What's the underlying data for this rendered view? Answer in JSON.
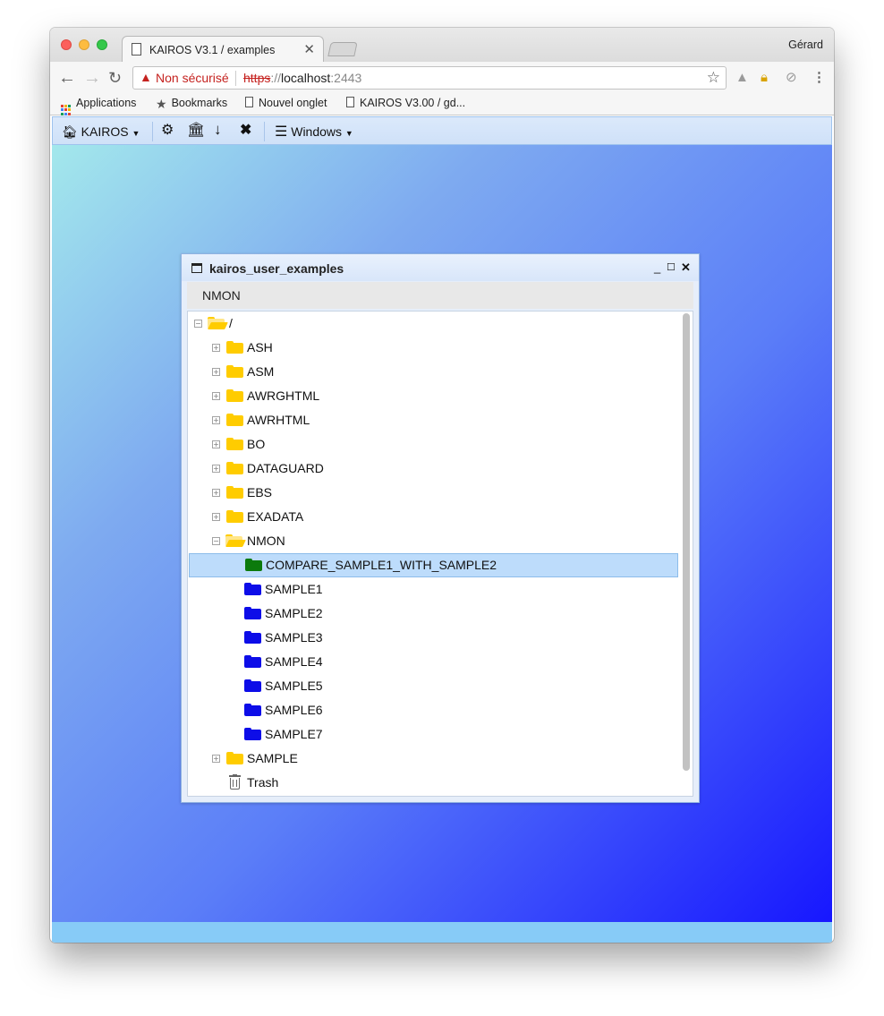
{
  "browser": {
    "tab_title": "KAIROS V3.1 / examples",
    "user": "Gérard",
    "address": {
      "warning": "Non sécurisé",
      "scheme": "https",
      "slashes": "://",
      "host": "localhost",
      "port": ":2443"
    },
    "bookmarks": [
      {
        "label": "Applications",
        "icon": "apps-grid-icon"
      },
      {
        "label": "Bookmarks",
        "icon": "star-icon"
      },
      {
        "label": "Nouvel onglet",
        "icon": "page-icon"
      },
      {
        "label": "KAIROS V3.00 / gd...",
        "icon": "page-icon"
      }
    ]
  },
  "app_toolbar": {
    "kairos_label": "KAIROS",
    "windows_label": "Windows",
    "icons": [
      "home-icon",
      "gear-icon",
      "bank-icon",
      "arrow-down-icon",
      "close-icon",
      "list-icon"
    ]
  },
  "dialog": {
    "title": "kairos_user_examples",
    "tab": "NMON",
    "tree": {
      "root": "/",
      "items": [
        {
          "label": "ASH",
          "color": "#ffcc00",
          "expanded": false
        },
        {
          "label": "ASM",
          "color": "#ffcc00",
          "expanded": false
        },
        {
          "label": "AWRGHTML",
          "color": "#ffcc00",
          "expanded": false
        },
        {
          "label": "AWRHTML",
          "color": "#ffcc00",
          "expanded": false
        },
        {
          "label": "BO",
          "color": "#ffcc00",
          "expanded": false
        },
        {
          "label": "DATAGUARD",
          "color": "#ffcc00",
          "expanded": false
        },
        {
          "label": "EBS",
          "color": "#ffcc00",
          "expanded": false
        },
        {
          "label": "EXADATA",
          "color": "#ffcc00",
          "expanded": false
        },
        {
          "label": "NMON",
          "color": "#ffcc00",
          "expanded": true
        },
        {
          "label": "COMPARE_SAMPLE1_WITH_SAMPLE2",
          "color": "#0c7a0c",
          "selected": true
        },
        {
          "label": "SAMPLE1",
          "color": "#0d0de8"
        },
        {
          "label": "SAMPLE2",
          "color": "#0d0de8"
        },
        {
          "label": "SAMPLE3",
          "color": "#0d0de8"
        },
        {
          "label": "SAMPLE4",
          "color": "#0d0de8"
        },
        {
          "label": "SAMPLE5",
          "color": "#0d0de8"
        },
        {
          "label": "SAMPLE6",
          "color": "#0d0de8"
        },
        {
          "label": "SAMPLE7",
          "color": "#0d0de8"
        },
        {
          "label": "SAMPLE",
          "color": "#ffcc00",
          "expanded": false
        },
        {
          "label": "Trash",
          "icon": "trash-icon"
        }
      ]
    }
  },
  "colors": {
    "selection": "#bddcfb",
    "desktop_gradient_start": "#a3e8ec",
    "desktop_gradient_end": "#1717ff",
    "statusbar": "#87cbf7"
  }
}
